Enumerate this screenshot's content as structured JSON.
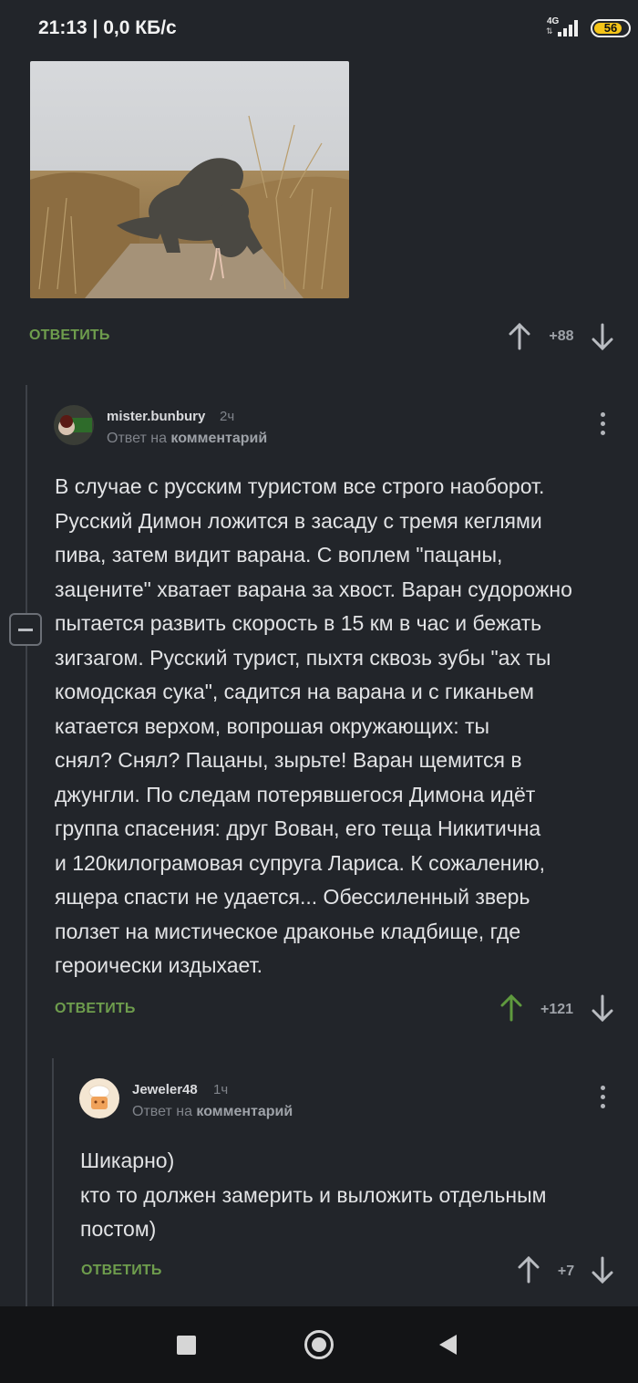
{
  "status_bar": {
    "time_speed": "21:13 | 0,0 КБ/с",
    "network": "4G",
    "network_arrows": "⇅",
    "battery": "56"
  },
  "post": {
    "reply_label": "ОТВЕТИТЬ",
    "rating": "+88"
  },
  "comments": [
    {
      "username": "mister.bunbury",
      "time": "2ч",
      "reply_prefix": "Ответ на",
      "reply_target": "комментарий",
      "text": "В случае с русским туристом все строго наоборот.\nРусский Димон ложится в засаду с тремя кеглями\nпива, затем видит варана. С воплем \"пацаны,\nзацените\" хватает варана за хвост. Варан судорожно\nпытается развить скорость в 15 км в час и бежать\nзигзагом. Русский турист, пыхтя сквозь зубы \"ах ты\nкомодская сука\", садится на варана и с гиканьем\nкатается верхом, вопрошая окружающих: ты\nснял? Снял? Пацаны, зырьте! Варан щемится в\nджунгли. По следам потерявшегося Димона идёт\nгруппа спасения: друг Вован, его теща Никитична\nи 120килограмовая супруга Лариса. К сожалению,\nящера спасти не удается... Обессиленный зверь\nползет на мистическое драконье кладбище, где\nгероически издыхает.",
      "reply_label": "ОТВЕТИТЬ",
      "rating": "+121"
    },
    {
      "username": "Jeweler48",
      "time": "1ч",
      "reply_prefix": "Ответ на",
      "reply_target": "комментарий",
      "text": "Шикарно)\nкто то должен замерить и выложить отдельным\nпостом)",
      "reply_label": "ОТВЕТИТЬ",
      "rating": "+7"
    }
  ],
  "colors": {
    "background": "#22252a",
    "accent_green": "#6e9d4d",
    "upvoted_green": "#5f9a3e",
    "muted": "#9ea2a8"
  },
  "icons": [
    "arrow-up-icon",
    "arrow-down-icon",
    "more-vertical-icon",
    "collapse-minus-icon",
    "nav-recents-icon",
    "nav-home-icon",
    "nav-back-icon"
  ]
}
